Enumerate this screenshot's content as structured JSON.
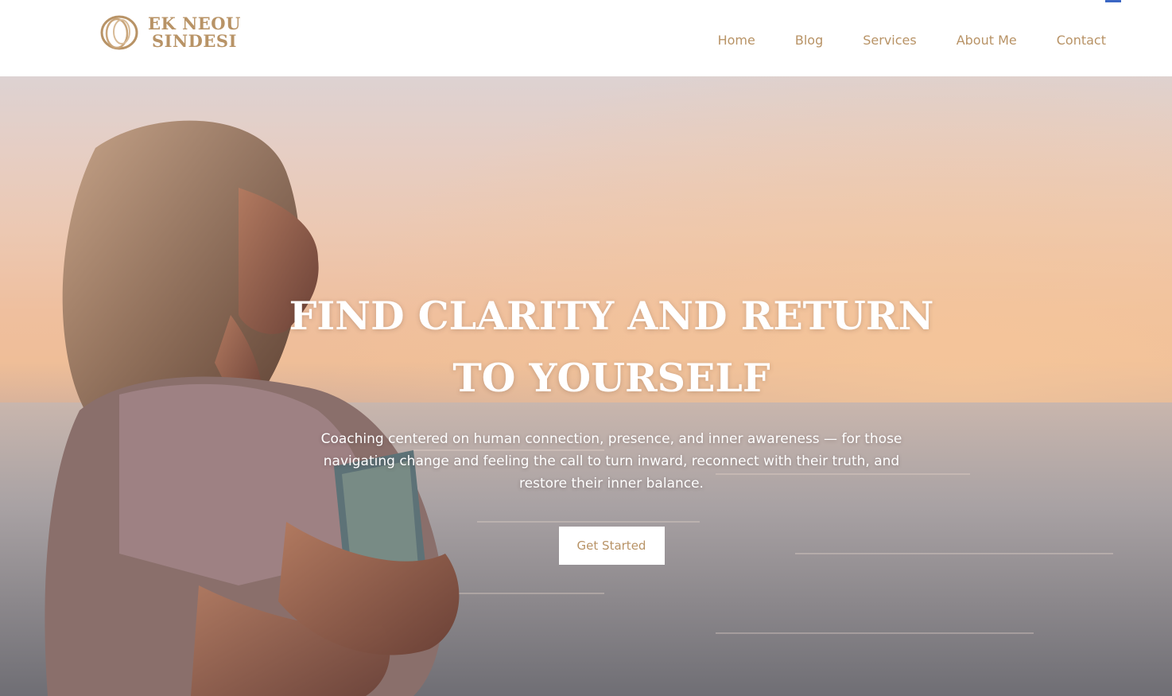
{
  "header": {
    "logo": {
      "line1": "EK NEOU",
      "line2": "SINDESI"
    },
    "nav": [
      {
        "label": "Home"
      },
      {
        "label": "Blog"
      },
      {
        "label": "Services"
      },
      {
        "label": "About Me"
      },
      {
        "label": "Contact"
      }
    ]
  },
  "hero": {
    "title_line1": "FIND CLARITY AND RETURN",
    "title_line2": "TO YOURSELF",
    "subtitle": "Coaching centered on human connection, presence, and inner awareness — for those navigating change and feeling the call to turn inward, reconnect with their truth, and restore their inner balance.",
    "cta_label": "Get Started"
  },
  "colors": {
    "brand": "#b89366",
    "header_bg": "#ffffff",
    "menu_indicator": "#3a66c4",
    "hero_text": "#ffffff"
  },
  "icons": {
    "logo": "intertwined-rings-logo-icon"
  }
}
